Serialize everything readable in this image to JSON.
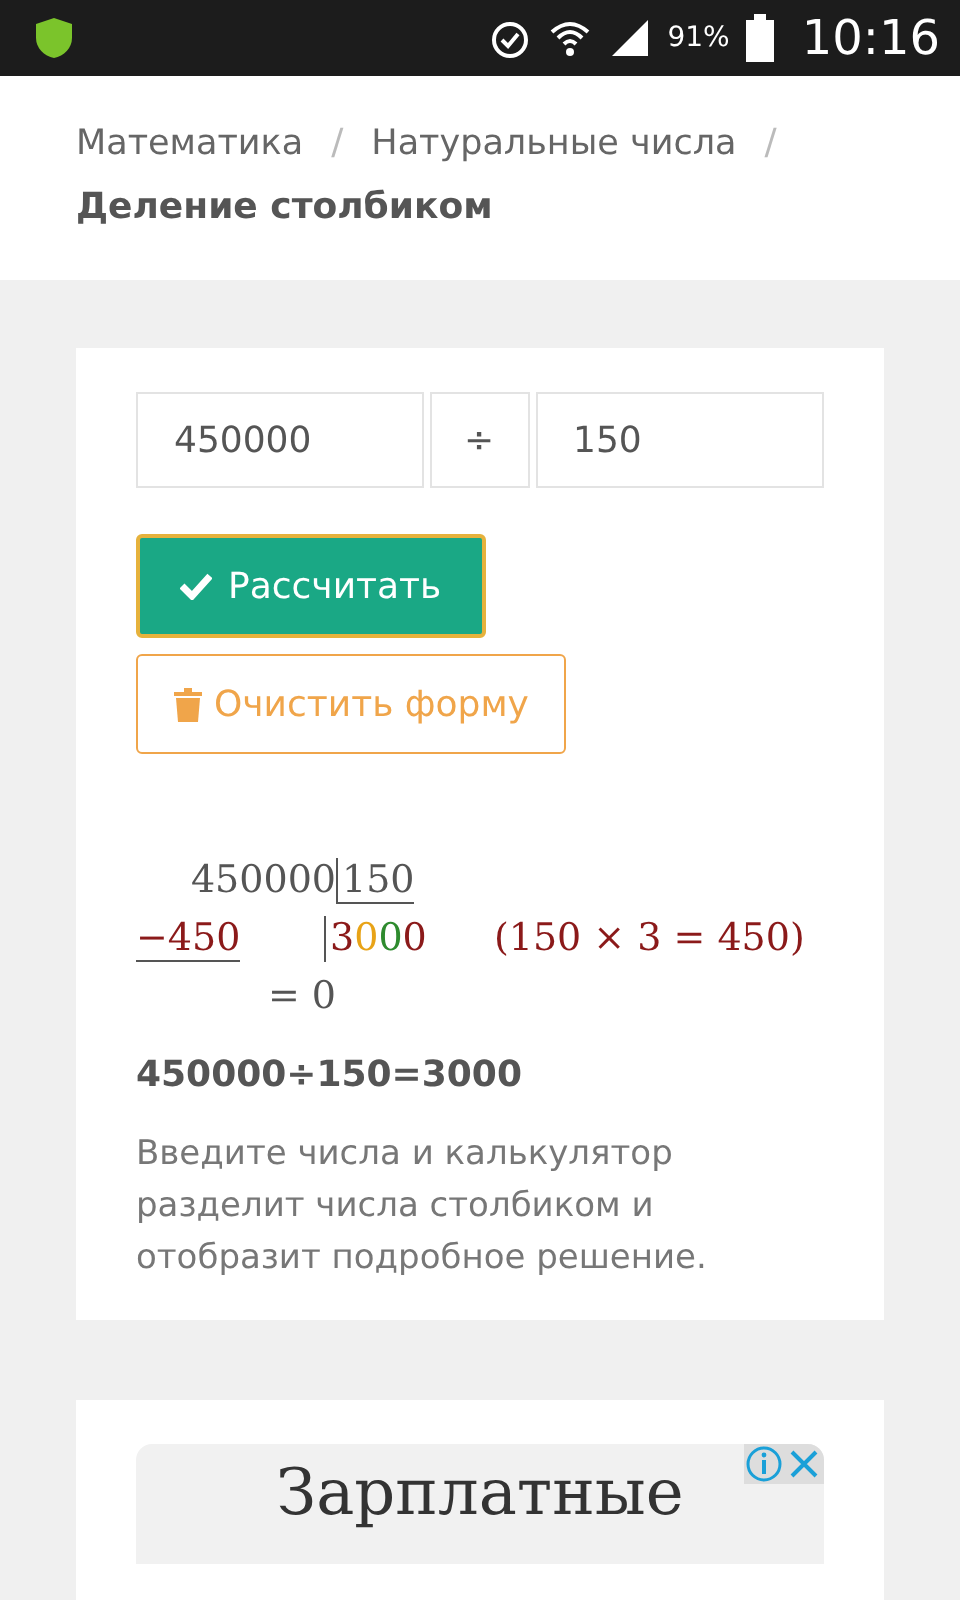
{
  "status_bar": {
    "battery": "91%",
    "time": "10:16"
  },
  "breadcrumbs": [
    {
      "label": "Математика",
      "current": false
    },
    {
      "label": "Натуральные числа",
      "current": false
    },
    {
      "label": "Деление столбиком",
      "current": true
    }
  ],
  "separator": "/",
  "form": {
    "dividend": "450000",
    "operator": "÷",
    "divisor": "150",
    "calculate_button": "Рассчитать",
    "clear_button": "Очистить форму"
  },
  "division": {
    "dividend": "450000",
    "divisor": "150",
    "subtrahend": "−450",
    "quotient_digits": [
      {
        "digit": "3",
        "color": "#8b1a1a"
      },
      {
        "digit": "0",
        "color": "#e8a317"
      },
      {
        "digit": "0",
        "color": "#2e8b2e"
      },
      {
        "digit": "0",
        "color": "#8b1a1a"
      }
    ],
    "step_note": "(150 × 3 = 450)",
    "remainder": "= 0"
  },
  "result": "450000÷150=3000",
  "description": "Введите числа и калькулятор разделит числа столбиком и отобразит подробное решение.",
  "ad": {
    "headline": "Зарплатные"
  }
}
